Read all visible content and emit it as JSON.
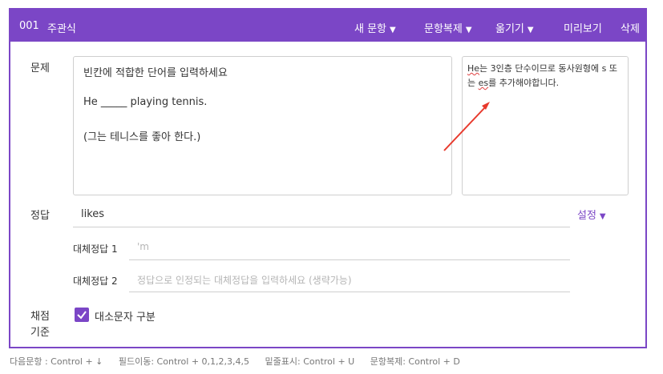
{
  "header": {
    "number": "001",
    "type": "주관식",
    "buttons": {
      "new": "새 문항",
      "copy": "문항복제",
      "move": "옮기기",
      "preview": "미리보기",
      "delete": "삭제"
    }
  },
  "question": {
    "label": "문제",
    "lines": [
      "빈칸에 적합한 단어를 입력하세요",
      "He _____ playing tennis.",
      "(그는 테니스를 좋아 한다.)"
    ]
  },
  "memo": {
    "part1": "He",
    "part2": "는 3인층 단수이므로 동사원형에 s 또는 ",
    "part3": "es",
    "part4": "를 추가해야합니다."
  },
  "answer": {
    "label": "정답",
    "value": "likes",
    "setting": "설정",
    "alternatives": [
      {
        "label": "대체정답 1",
        "value": "'m"
      },
      {
        "label": "대체정답 2",
        "placeholder": "정답으로 인정되는 대체정답을 입력하세요 (생략가능)"
      }
    ]
  },
  "grading": {
    "label_line1": "채점",
    "label_line2": "기준",
    "case_sensitive_label": "대소문자 구분",
    "case_sensitive_checked": true
  },
  "footer": {
    "next": "다음문항 : Control + ↓",
    "field_move": "필드이동: Control + 0,1,2,3,4,5",
    "underline": "밑줄표시: Control + U",
    "copy": "문항복제: Control + D"
  },
  "colors": {
    "accent": "#7b46c6",
    "arrow": "#e8392c"
  }
}
